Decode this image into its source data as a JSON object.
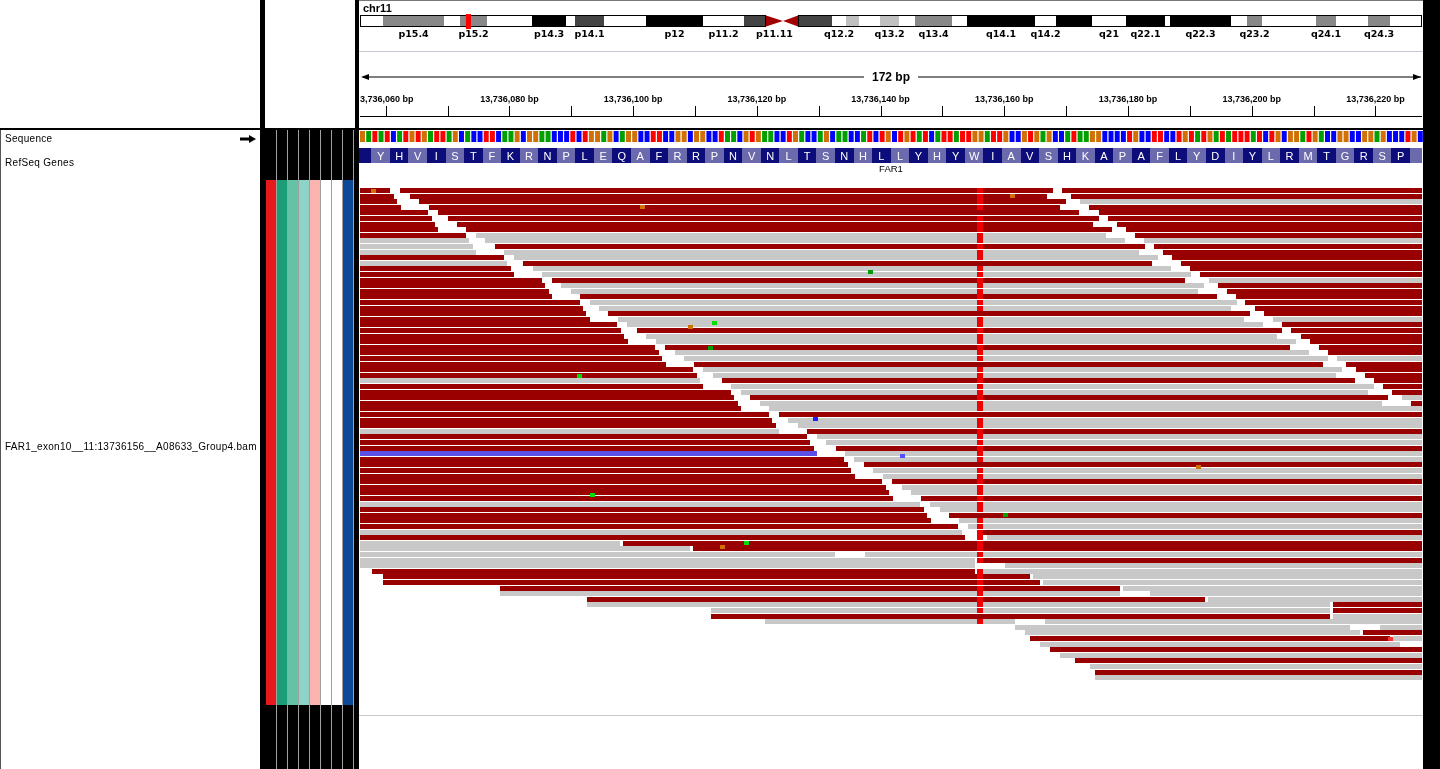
{
  "header": {
    "chromosome": "chr11",
    "ideogram": [
      {
        "kind": "band",
        "current": false
      },
      {
        "kind": "band",
        "color": "#888888",
        "label": "p15.4",
        "current": false
      },
      {
        "kind": "band",
        "current": false
      },
      {
        "kind": "band",
        "color": "#888888",
        "label": "p15.2",
        "current": true
      },
      {
        "kind": "band",
        "current": false
      },
      {
        "kind": "band",
        "color": "#000000",
        "label": "p14.3",
        "current": false
      },
      {
        "kind": "band",
        "current": false
      },
      {
        "kind": "band",
        "color": "#444444",
        "label": "p14.1",
        "current": false
      },
      {
        "kind": "band",
        "current": false
      },
      {
        "kind": "band",
        "color": "#000000",
        "label": "p12",
        "current": false
      },
      {
        "kind": "band",
        "label": "p11.2",
        "current": false
      },
      {
        "kind": "band",
        "color": "#444444",
        "current": false
      },
      {
        "kind": "centromere",
        "color": "#a00000",
        "label": "p11.11",
        "current": false
      },
      {
        "kind": "centromere",
        "color": "#a00000",
        "current": false
      },
      {
        "kind": "band",
        "color": "#444444",
        "current": false
      },
      {
        "kind": "band",
        "label": "q12.2",
        "current": false
      },
      {
        "kind": "band",
        "color": "#c0c0c0",
        "current": false
      },
      {
        "kind": "band",
        "current": false
      },
      {
        "kind": "band",
        "color": "#c0c0c0",
        "label": "q13.2",
        "current": false
      },
      {
        "kind": "band",
        "current": false
      },
      {
        "kind": "band",
        "color": "#888888",
        "label": "q13.4",
        "current": false
      },
      {
        "kind": "band",
        "current": false
      },
      {
        "kind": "band",
        "color": "#000000",
        "label": "q14.1",
        "current": false
      },
      {
        "kind": "band",
        "label": "q14.2",
        "current": false
      },
      {
        "kind": "band",
        "color": "#000000",
        "current": false
      },
      {
        "kind": "band",
        "label": "q21",
        "current": false
      },
      {
        "kind": "band",
        "color": "#000000",
        "label": "q22.1",
        "current": false
      },
      {
        "kind": "band",
        "current": false
      },
      {
        "kind": "band",
        "color": "#000000",
        "label": "q22.3",
        "current": false
      },
      {
        "kind": "band",
        "current": false
      },
      {
        "kind": "band",
        "color": "#888888",
        "label": "q23.2",
        "current": false
      },
      {
        "kind": "band",
        "current": false
      },
      {
        "kind": "band",
        "color": "#888888",
        "label": "q24.1",
        "current": false
      },
      {
        "kind": "band",
        "current": false
      },
      {
        "kind": "band",
        "color": "#888888",
        "label": "q24.3",
        "current": false
      },
      {
        "kind": "band",
        "current": false
      }
    ],
    "ruler": {
      "span": "172 bp",
      "ticks": [
        "3,736,060 bp",
        "13,736,080 bp",
        "13,736,100 bp",
        "13,736,120 bp",
        "13,736,140 bp",
        "13,736,160 bp",
        "13,736,180 bp",
        "13,736,200 bp",
        "13,736,220 bp"
      ]
    }
  },
  "tracks": [
    {
      "kind": "sequence",
      "name": "Sequence",
      "forward": true
    },
    {
      "kind": "gene",
      "name": "RefSeq Genes",
      "gene": "FAR1",
      "amino_acids": [
        "Y",
        "H",
        "V",
        "I",
        "S",
        "T",
        "F",
        "K",
        "R",
        "N",
        "P",
        "L",
        "E",
        "Q",
        "A",
        "F",
        "R",
        "R",
        "P",
        "N",
        "V",
        "N",
        "L",
        "T",
        "S",
        "N",
        "H",
        "L",
        "L",
        "Y",
        "H",
        "Y",
        "W",
        "I",
        "A",
        "V",
        "S",
        "H",
        "K",
        "A",
        "P",
        "A",
        "F",
        "L",
        "Y",
        "D",
        "I",
        "Y",
        "L",
        "R",
        "M",
        "T",
        "G",
        "R",
        "S",
        "P"
      ]
    },
    {
      "kind": "alignment",
      "name": "FAR1_exon10__11:13736156__A08633_Group4.bam",
      "attributes": [
        {
          "color": "#e41a1c"
        },
        {
          "color": "#1b9e77"
        },
        {
          "color": "#66c2a5"
        },
        {
          "color": "#8dd3c7"
        },
        {
          "color": "#fbb4ae"
        },
        {
          "color": "#ffffff"
        },
        {
          "color": "#ffffff"
        },
        {
          "color": "#0c4a97"
        }
      ]
    }
  ]
}
